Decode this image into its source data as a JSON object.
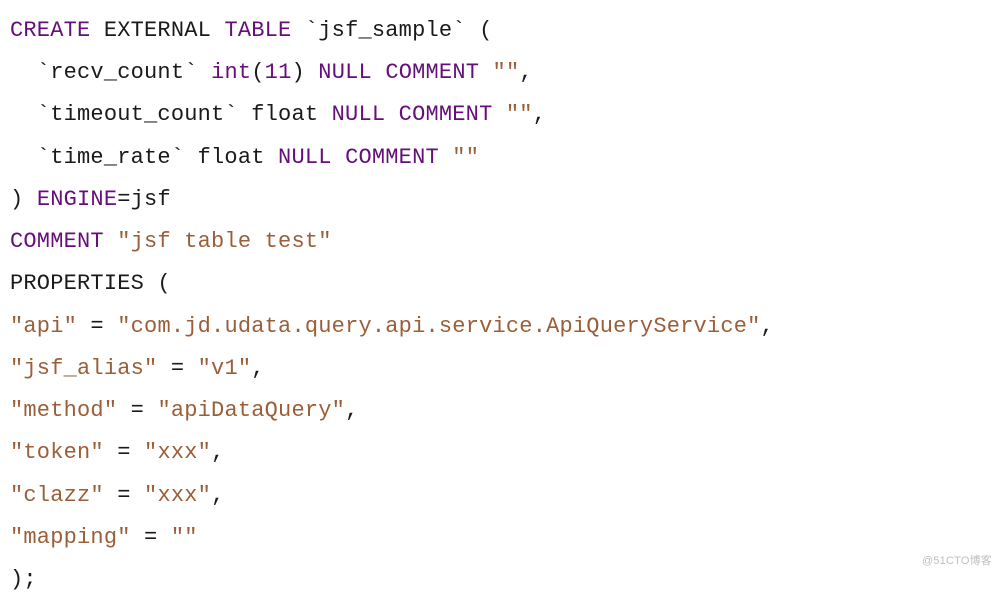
{
  "code": {
    "l1": {
      "kw1": "CREATE",
      "t1": " EXTERNAL ",
      "kw2": "TABLE",
      "t2": " `jsf_sample` ("
    },
    "l2": {
      "t1": "  `recv_count` ",
      "kw1": "int",
      "t2": "(",
      "kw2": "11",
      "t3": ") ",
      "kw3": "NULL",
      "t4": " ",
      "kw4": "COMMENT",
      "t5": " ",
      "s1": "\"\"",
      "t6": ","
    },
    "l3": {
      "t1": "  `timeout_count` float ",
      "kw1": "NULL",
      "t2": " ",
      "kw2": "COMMENT",
      "t3": " ",
      "s1": "\"\"",
      "t4": ","
    },
    "l4": {
      "t1": "  `time_rate` float ",
      "kw1": "NULL",
      "t2": " ",
      "kw2": "COMMENT",
      "t3": " ",
      "s1": "\"\""
    },
    "l5": {
      "t1": ") ",
      "kw1": "ENGINE",
      "t2": "=jsf"
    },
    "l6": {
      "kw1": "COMMENT",
      "t1": " ",
      "s1": "\"jsf table test\""
    },
    "l7": {
      "t1": "PROPERTIES ("
    },
    "l8": {
      "s1": "\"api\"",
      "t1": " = ",
      "s2": "\"com.jd.udata.query.api.service.ApiQueryService\"",
      "t2": ","
    },
    "l9": {
      "s1": "\"jsf_alias\"",
      "t1": " = ",
      "s2": "\"v1\"",
      "t2": ","
    },
    "l10": {
      "s1": "\"method\"",
      "t1": " = ",
      "s2": "\"apiDataQuery\"",
      "t2": ","
    },
    "l11": {
      "s1": "\"token\"",
      "t1": " = ",
      "s2": "\"xxx\"",
      "t2": ","
    },
    "l12": {
      "s1": "\"clazz\"",
      "t1": " = ",
      "s2": "\"xxx\"",
      "t2": ","
    },
    "l13": {
      "s1": "\"mapping\"",
      "t1": " = ",
      "s2": "\"\""
    },
    "l14": {
      "t1": ");"
    }
  },
  "watermark": "@51CTO博客"
}
